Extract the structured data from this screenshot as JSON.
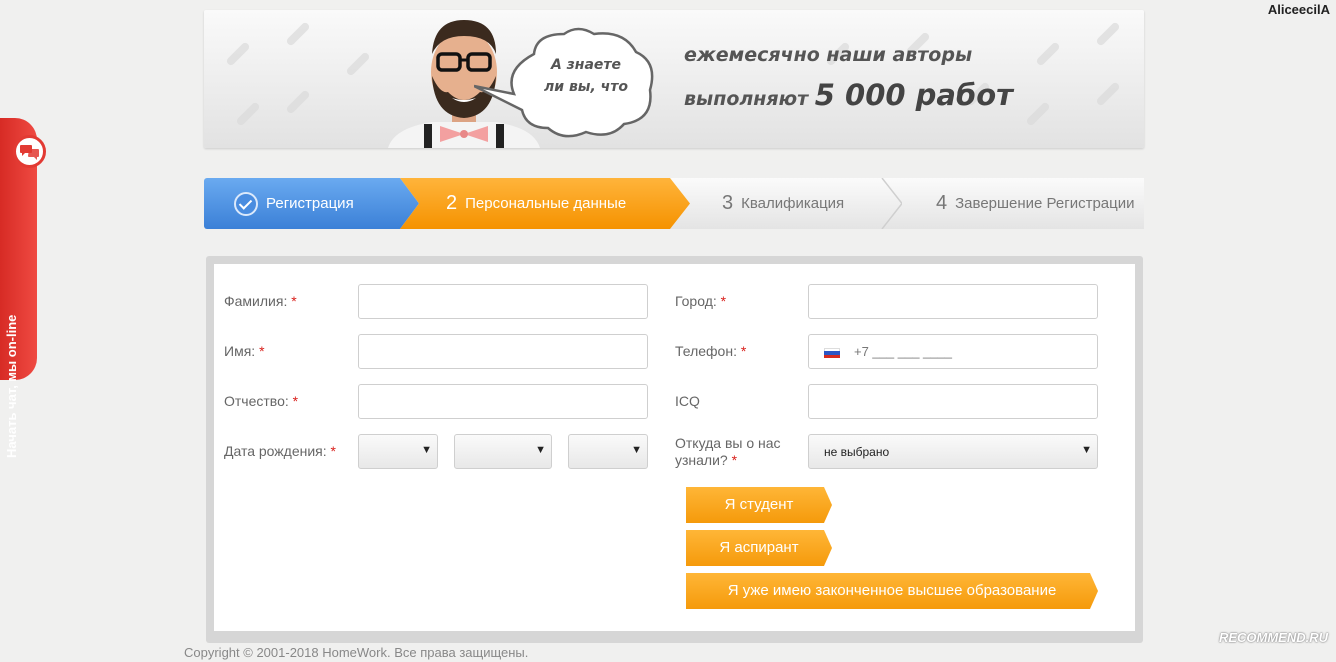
{
  "user": {
    "name": "AliceecilA"
  },
  "chat": {
    "label": "Начать чат, мы on-line",
    "icon": "chat-bubbles-icon"
  },
  "banner": {
    "bubble_line1": "А знаете",
    "bubble_line2": "ли вы, что",
    "line1": "ежемесячно наши авторы",
    "line2_prefix": "выполняют",
    "line2_big": "5 000 работ"
  },
  "steps": [
    {
      "num": "",
      "label": "Регистрация",
      "state": "done"
    },
    {
      "num": "2",
      "label": "Персональные данные",
      "state": "active"
    },
    {
      "num": "3",
      "label": "Квалификация",
      "state": "pending"
    },
    {
      "num": "4",
      "label": "Завершение Регистрации",
      "state": "pending"
    }
  ],
  "form": {
    "surname_label": "Фамилия:",
    "name_label": "Имя:",
    "patronymic_label": "Отчество:",
    "birthdate_label": "Дата рождения:",
    "city_label": "Город:",
    "phone_label": "Телефон:",
    "phone_mask": "+7 ___ ___ ____",
    "icq_label": "ICQ",
    "source_label_1": "Откуда вы о нас",
    "source_label_2": "узнали?",
    "source_value": "не выбрано",
    "required_mark": "*"
  },
  "buttons": {
    "student": "Я студент",
    "postgrad": "Я аспирант",
    "graduate": "Я уже имею законченное высшее образование"
  },
  "footer": "Copyright © 2001-2018 HomeWork. Все права защищены.",
  "watermark": "RECOMMEND.RU",
  "colors": {
    "blue": "#3b80d7",
    "orange": "#f59a0b",
    "red": "#e23a33"
  }
}
